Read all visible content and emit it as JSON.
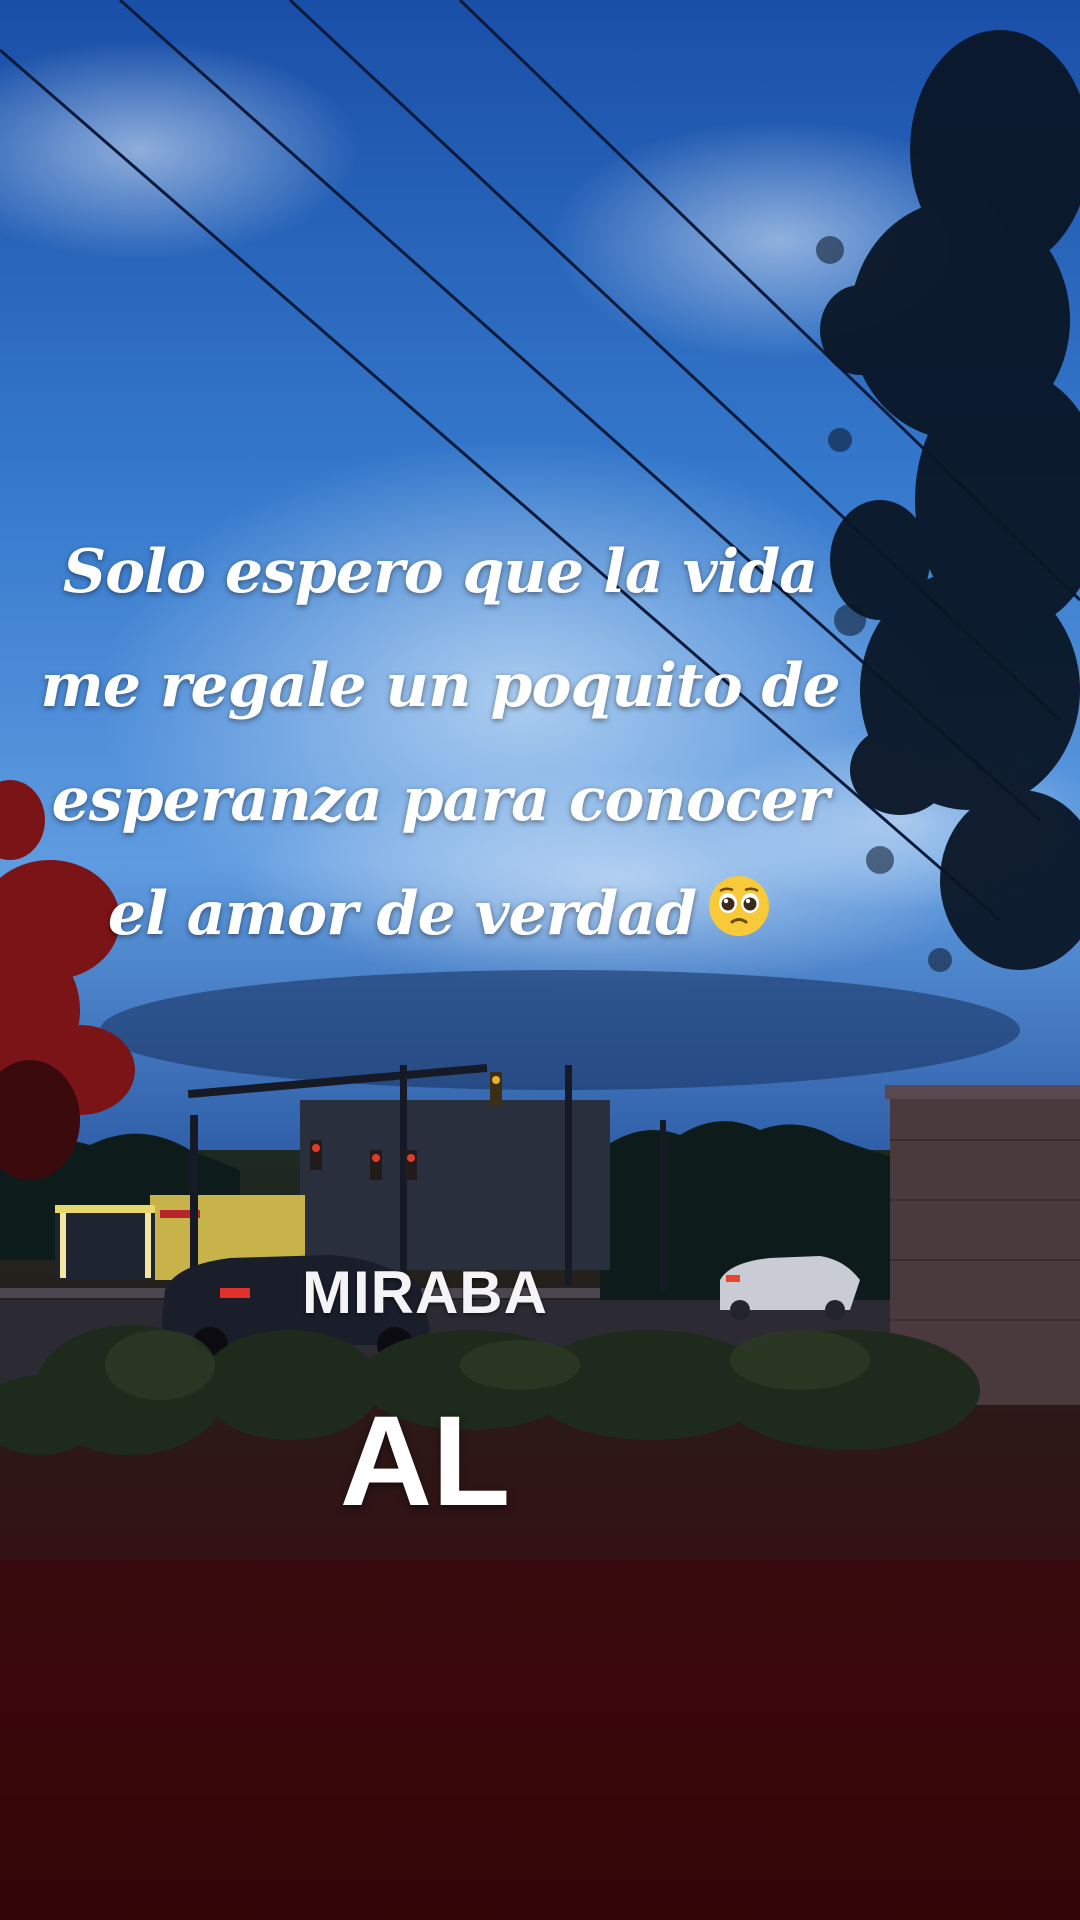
{
  "quote": {
    "lines": [
      "Solo espero que la vida",
      "me regale un poquito de",
      "esperanza para conocer",
      "el amor de verdad"
    ],
    "emoji": "pleading-face-emoji"
  },
  "overlay": {
    "word1": "MIRABA",
    "word2": "AL"
  },
  "colors": {
    "sky_top": "#1a56b8",
    "sky_mid": "#3f86d8",
    "sky_horizon": "#1c3e7a",
    "ground": "#3a0b12",
    "text": "#ffffff"
  }
}
